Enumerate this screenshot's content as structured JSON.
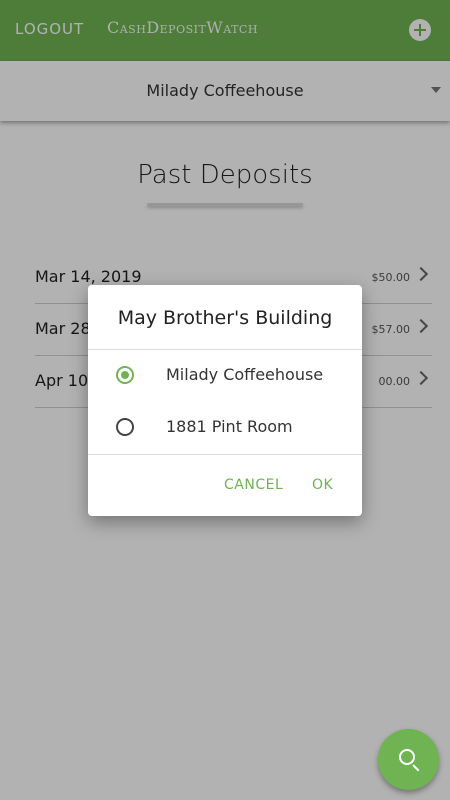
{
  "header": {
    "logout_label": "LOGOUT",
    "brand": "CashDepositWatch",
    "add_icon": "plus-circle-icon"
  },
  "location": {
    "selected": "Milady Coffeehouse"
  },
  "section": {
    "title": "Past Deposits"
  },
  "deposits": [
    {
      "date": "Mar 14, 2019",
      "amount": "$50.00"
    },
    {
      "date": "Mar 28",
      "amount": "$57.00"
    },
    {
      "date": "Apr 10,",
      "amount": "00.00"
    }
  ],
  "dialog": {
    "title": "May Brother's Building",
    "options": [
      {
        "label": "Milady Coffeehouse",
        "selected": true
      },
      {
        "label": "1881 Pint Room",
        "selected": false
      }
    ],
    "cancel_label": "CANCEL",
    "ok_label": "OK"
  },
  "fab": {
    "icon": "search-icon"
  },
  "colors": {
    "accent": "#6fb352",
    "overlay": "rgba(0,0,0,0.30)"
  }
}
